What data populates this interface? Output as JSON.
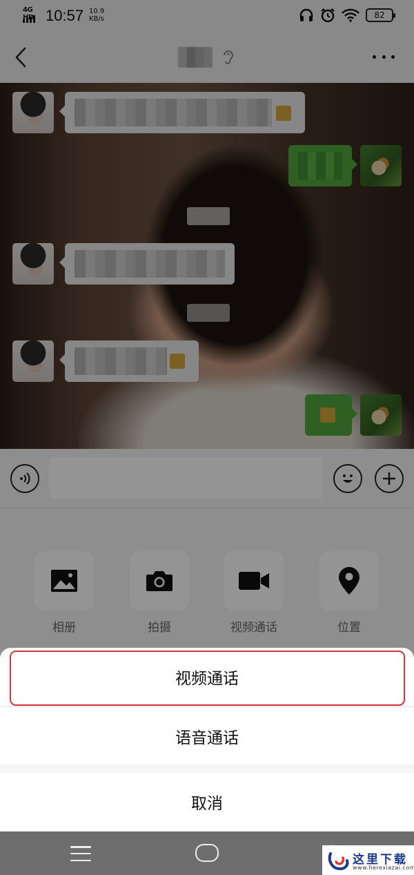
{
  "status_bar": {
    "network": "4G HD",
    "time": "10:57",
    "speed_value": "10.9",
    "speed_unit": "KB/s",
    "battery": "82",
    "icons": [
      "headset-icon",
      "alarm-icon",
      "wifi-icon",
      "battery-icon"
    ]
  },
  "nav": {
    "title": "",
    "icons": [
      "back-icon",
      "ear-icon",
      "more-icon"
    ]
  },
  "chat": {
    "messages": [
      {
        "side": "left",
        "avatar": "girl-avatar"
      },
      {
        "side": "right",
        "avatar": "cat-avatar"
      },
      {
        "side": "left",
        "avatar": "girl-avatar"
      },
      {
        "side": "left",
        "avatar": "girl-avatar"
      },
      {
        "side": "right",
        "avatar": "cat-avatar"
      }
    ]
  },
  "input_bar": {
    "icons": [
      "voice-icon",
      "emoji-icon",
      "plus-icon"
    ]
  },
  "tools": [
    {
      "label": "相册",
      "icon": "image-icon"
    },
    {
      "label": "拍摄",
      "icon": "camera-icon"
    },
    {
      "label": "视频通话",
      "icon": "video-icon"
    },
    {
      "label": "位置",
      "icon": "location-icon"
    }
  ],
  "action_sheet": {
    "video_call": "视频通话",
    "voice_call": "语音通话",
    "cancel": "取消"
  },
  "watermark": {
    "text": "这里下载",
    "url": "www.herexiazai.com"
  },
  "colors": {
    "highlight": "#d0333b",
    "bubble_green": "#4fa63c",
    "background": "#ededed"
  }
}
